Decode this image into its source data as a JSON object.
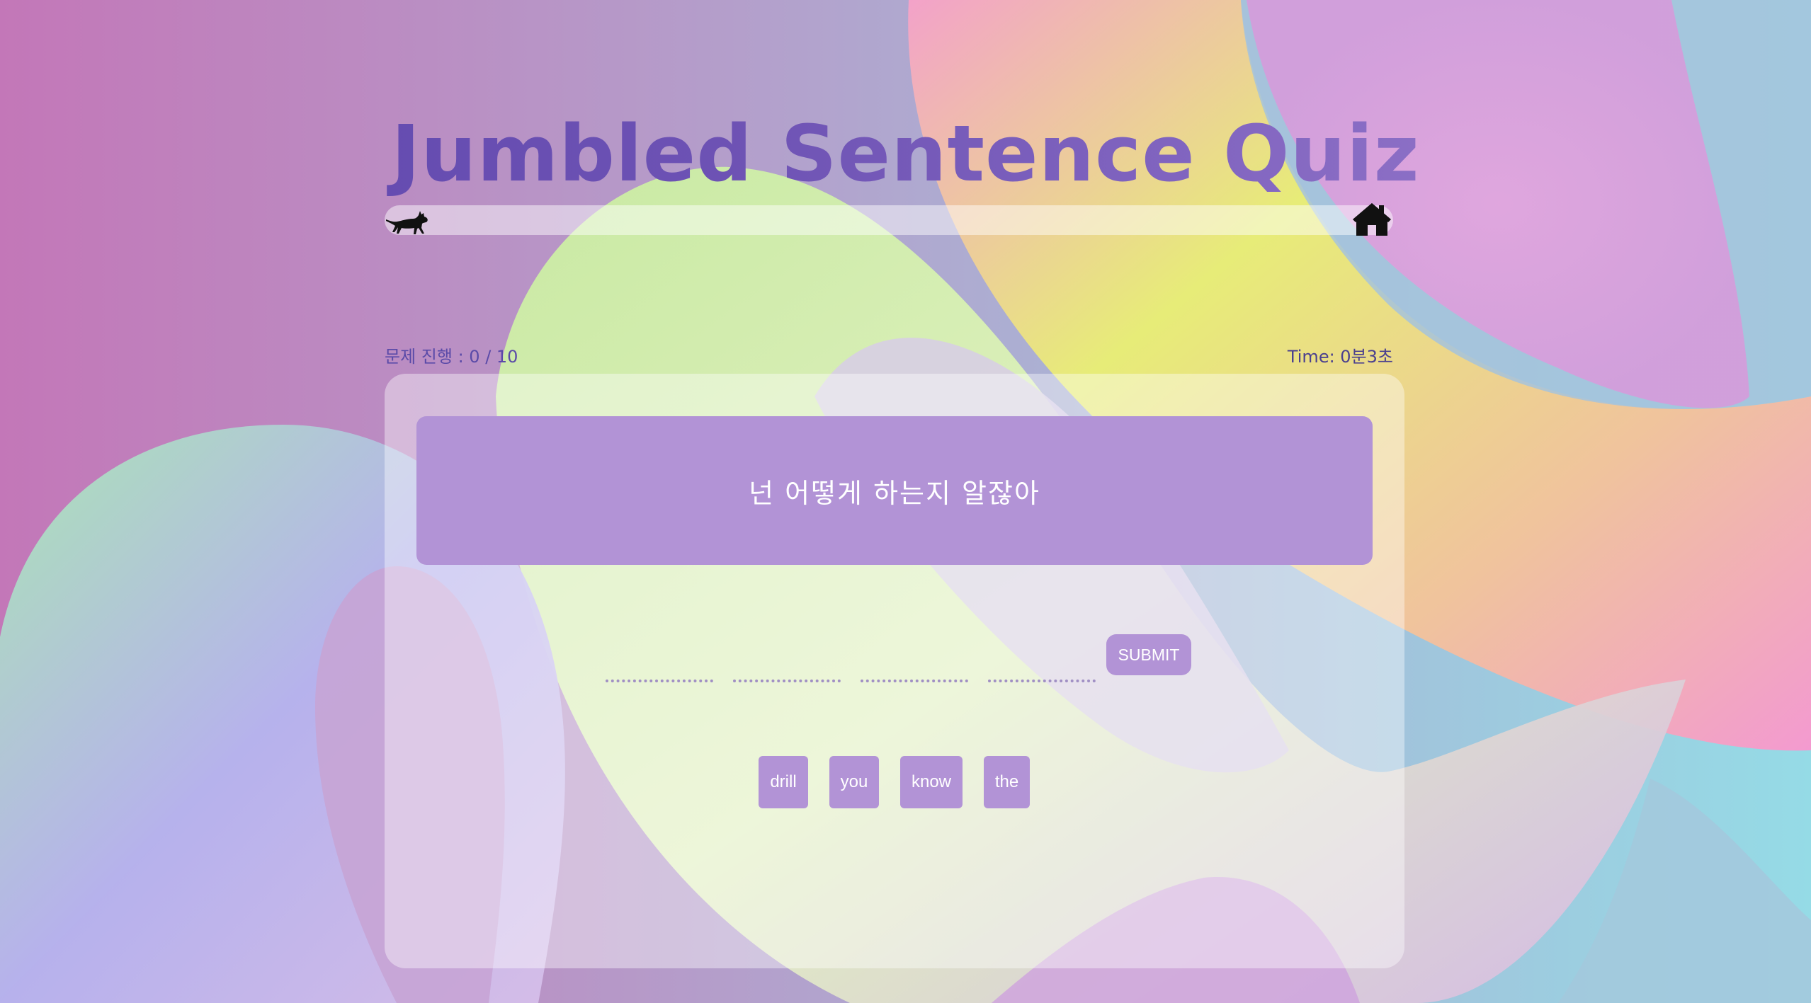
{
  "app": {
    "title": "Jumbled Sentence Quiz"
  },
  "progress_track": {
    "start_icon": "cat-icon",
    "end_icon": "home-icon",
    "progress_fraction": 0.0
  },
  "status": {
    "progress_text": "문제 진행 : 0 / 10",
    "time_text": "Time: 0분3초"
  },
  "question": {
    "prompt": "넌 어떻게 하는지 알잖아",
    "answer_slots": [
      "",
      "",
      "",
      ""
    ]
  },
  "submit": {
    "label": "SUBMIT"
  },
  "word_bank": [
    {
      "label": "drill"
    },
    {
      "label": "you"
    },
    {
      "label": "know"
    },
    {
      "label": "the"
    }
  ],
  "colors": {
    "accent": "#b293d6",
    "title_start": "#5d46ad",
    "title_end": "#9c7ecf",
    "card": "rgba(255,255,255,0.40)"
  }
}
